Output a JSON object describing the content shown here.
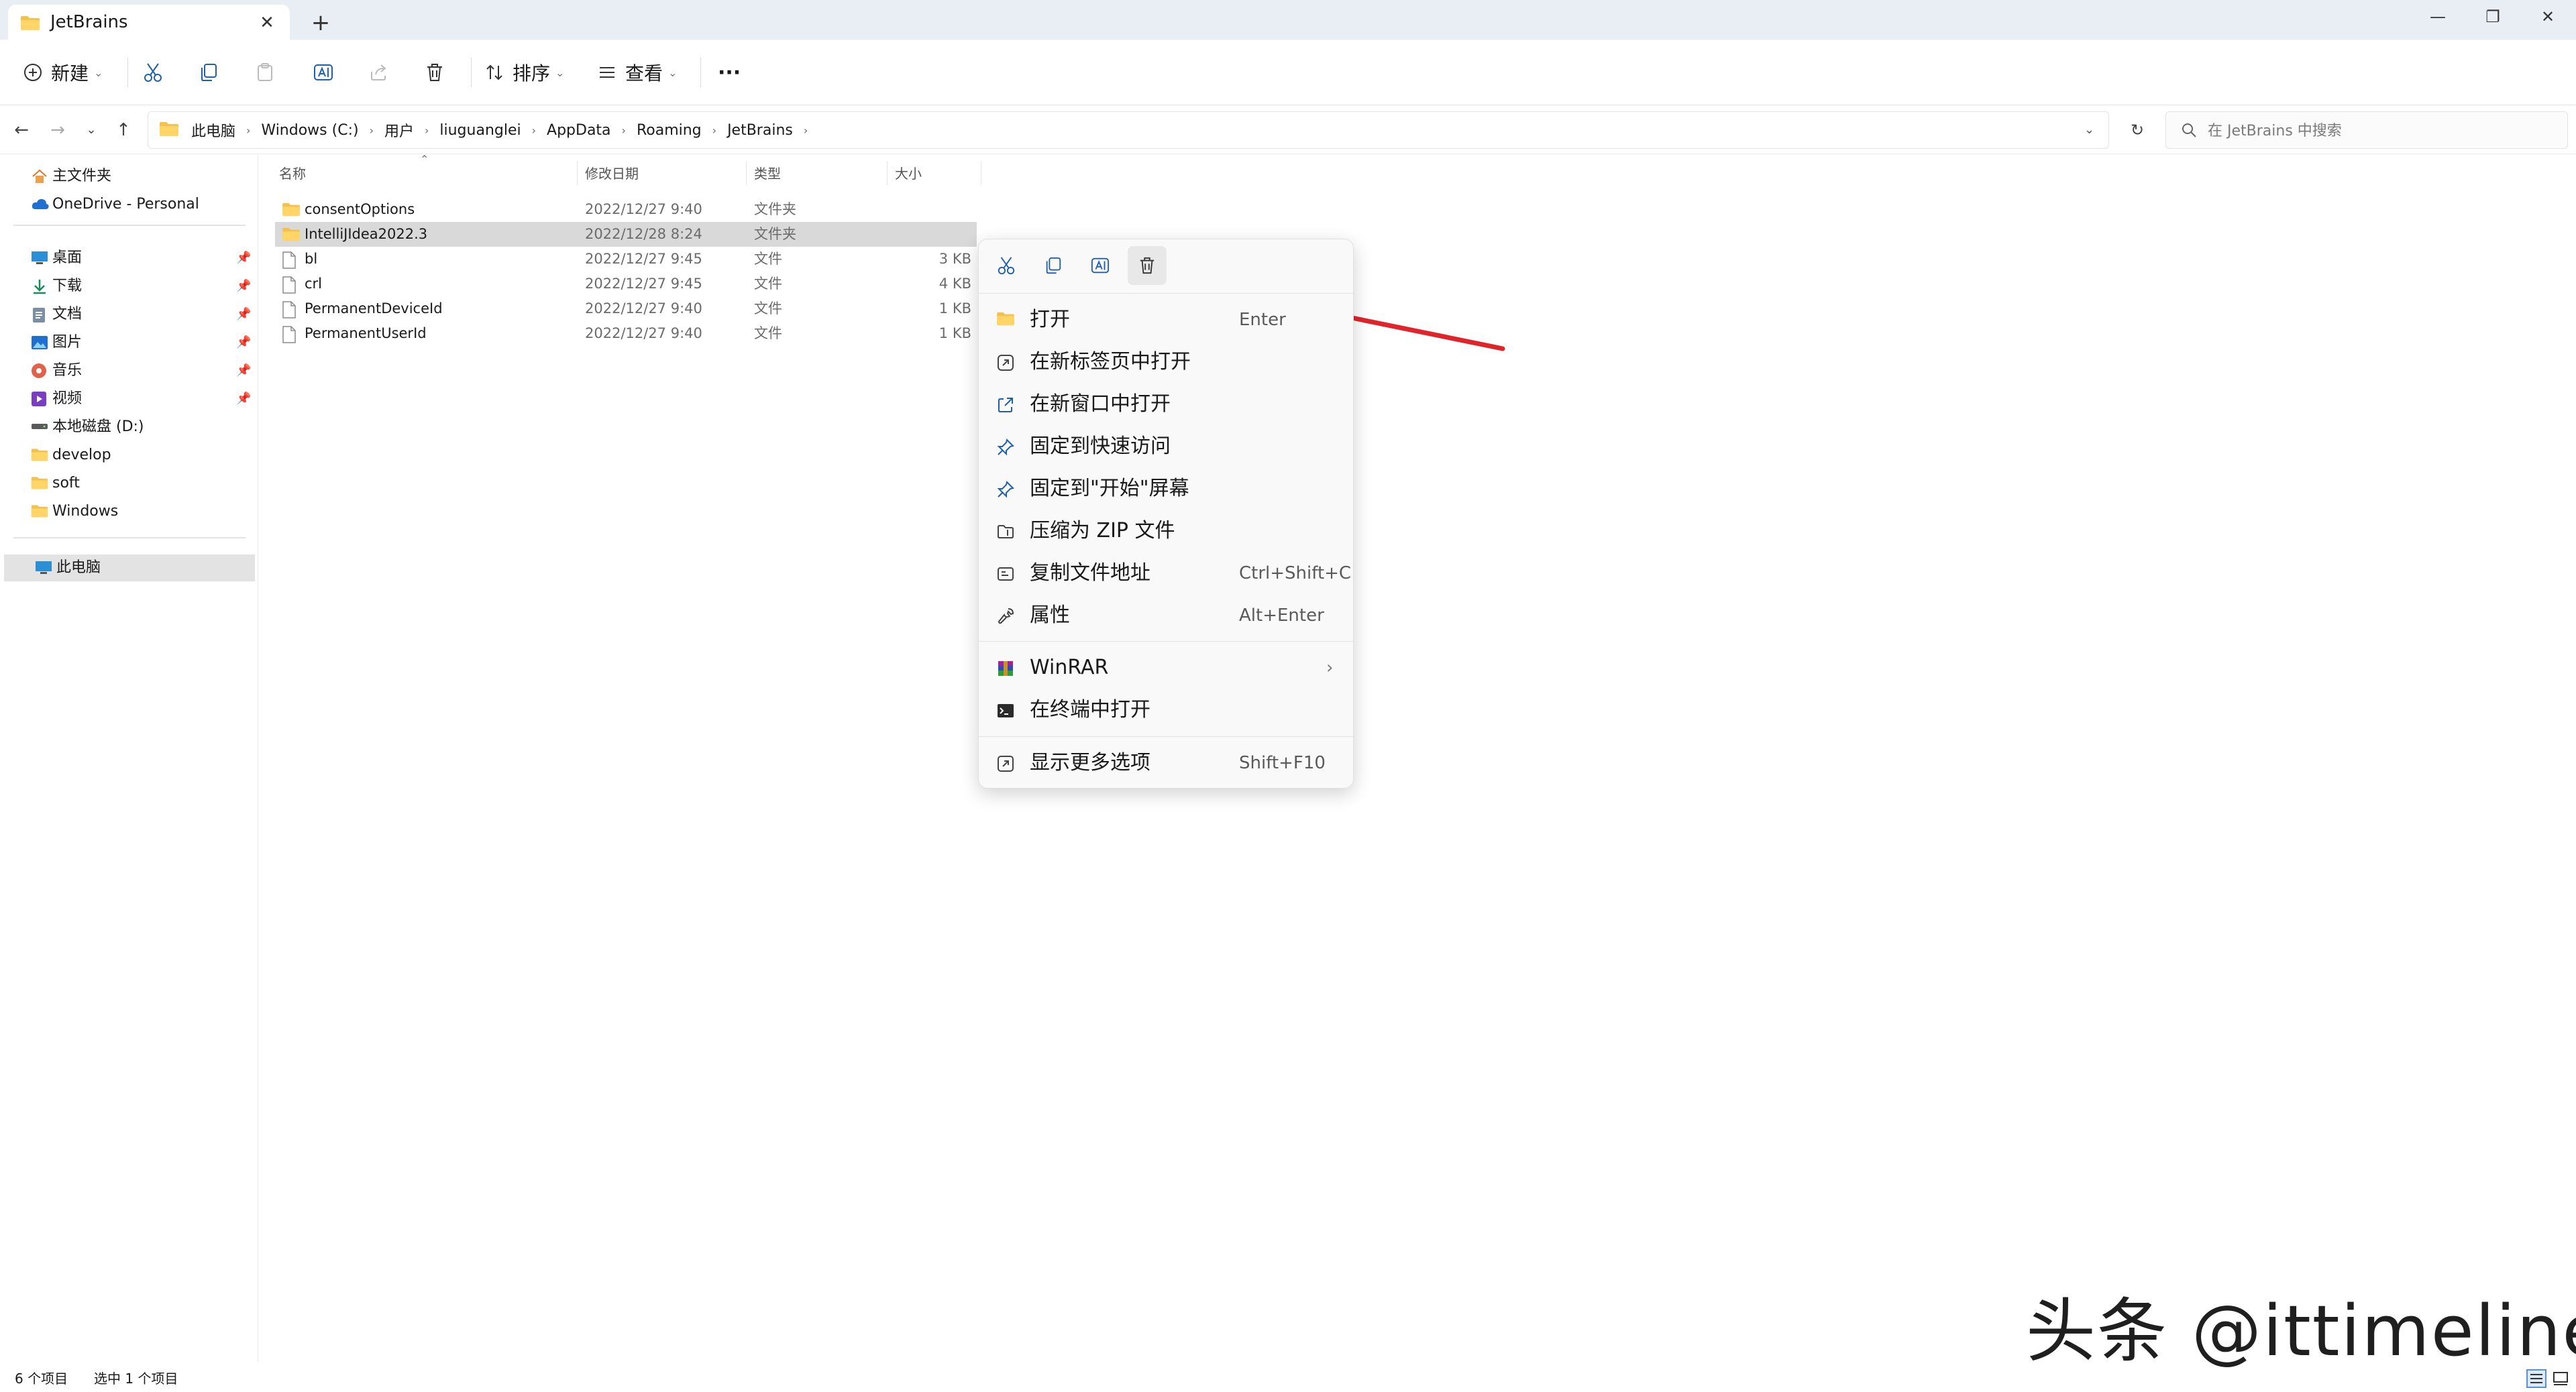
{
  "window": {
    "tab_title": "JetBrains",
    "tab_close": "✕",
    "new_tab": "+",
    "minimize": "—",
    "restore": "❐",
    "close": "✕"
  },
  "toolbar": {
    "new_label": "新建",
    "sort_label": "排序",
    "view_label": "查看",
    "more_label": "···"
  },
  "address": {
    "crumbs": [
      "此电脑",
      "Windows (C:)",
      "用户",
      "liuguanglei",
      "AppData",
      "Roaming",
      "JetBrains"
    ],
    "search_placeholder": "在 JetBrains 中搜索"
  },
  "sidebar": {
    "items": [
      {
        "label": "主文件夹",
        "icon": "home-icon",
        "pinned": false
      },
      {
        "label": "OneDrive - Personal",
        "icon": "cloud-icon",
        "pinned": false
      },
      {
        "label": "桌面",
        "icon": "desktop-icon",
        "pinned": true
      },
      {
        "label": "下载",
        "icon": "download-icon",
        "pinned": true
      },
      {
        "label": "文档",
        "icon": "document-icon",
        "pinned": true
      },
      {
        "label": "图片",
        "icon": "picture-icon",
        "pinned": true
      },
      {
        "label": "音乐",
        "icon": "music-icon",
        "pinned": true
      },
      {
        "label": "视频",
        "icon": "video-icon",
        "pinned": true
      },
      {
        "label": "本地磁盘 (D:)",
        "icon": "drive-icon",
        "pinned": false
      },
      {
        "label": "develop",
        "icon": "folder-icon",
        "pinned": false
      },
      {
        "label": "soft",
        "icon": "folder-icon",
        "pinned": false
      },
      {
        "label": "Windows",
        "icon": "folder-icon",
        "pinned": false
      },
      {
        "label": "此电脑",
        "icon": "computer-icon",
        "pinned": false
      }
    ],
    "pin_glyph": "📌"
  },
  "columns": {
    "name": "名称",
    "modified": "修改日期",
    "type": "类型",
    "size": "大小"
  },
  "files": [
    {
      "name": "consentOptions",
      "date": "2022/12/27 9:40",
      "type": "文件夹",
      "size": "",
      "kind": "folder"
    },
    {
      "name": "IntelliJIdea2022.3",
      "date": "2022/12/28 8:24",
      "type": "文件夹",
      "size": "",
      "kind": "folder",
      "selected": true
    },
    {
      "name": "bl",
      "date": "2022/12/27 9:45",
      "type": "文件",
      "size": "3 KB",
      "kind": "file"
    },
    {
      "name": "crl",
      "date": "2022/12/27 9:45",
      "type": "文件",
      "size": "4 KB",
      "kind": "file"
    },
    {
      "name": "PermanentDeviceId",
      "date": "2022/12/27 9:40",
      "type": "文件",
      "size": "1 KB",
      "kind": "file"
    },
    {
      "name": "PermanentUserId",
      "date": "2022/12/27 9:40",
      "type": "文件",
      "size": "1 KB",
      "kind": "file"
    }
  ],
  "context_menu": {
    "quick_actions": [
      "cut-icon",
      "copy-icon",
      "rename-icon",
      "delete-icon"
    ],
    "items": [
      {
        "label": "打开",
        "shortcut": "Enter",
        "icon": "open-folder-icon"
      },
      {
        "label": "在新标签页中打开",
        "shortcut": "",
        "icon": "new-tab-icon"
      },
      {
        "label": "在新窗口中打开",
        "shortcut": "",
        "icon": "new-window-icon"
      },
      {
        "label": "固定到快速访问",
        "shortcut": "",
        "icon": "pin-icon"
      },
      {
        "label": "固定到\"开始\"屏幕",
        "shortcut": "",
        "icon": "pin-icon"
      },
      {
        "label": "压缩为 ZIP 文件",
        "shortcut": "",
        "icon": "zip-icon"
      },
      {
        "label": "复制文件地址",
        "shortcut": "Ctrl+Shift+C",
        "icon": "copy-path-icon"
      },
      {
        "label": "属性",
        "shortcut": "Alt+Enter",
        "icon": "wrench-icon"
      },
      {
        "label": "WinRAR",
        "shortcut": "",
        "icon": "winrar-icon",
        "arrow": "›"
      },
      {
        "label": "在终端中打开",
        "shortcut": "",
        "icon": "terminal-icon"
      },
      {
        "label": "显示更多选项",
        "shortcut": "Shift+F10",
        "icon": "more-options-icon"
      }
    ]
  },
  "status": {
    "count": "6 个项目",
    "selected": "选中 1 个项目"
  },
  "watermark": "头条 @ittimeline",
  "colors": {
    "accent": "#0067c0",
    "folder": "#f4c04e",
    "selection": "#d9d9d9",
    "arrow": "#e0242a"
  }
}
